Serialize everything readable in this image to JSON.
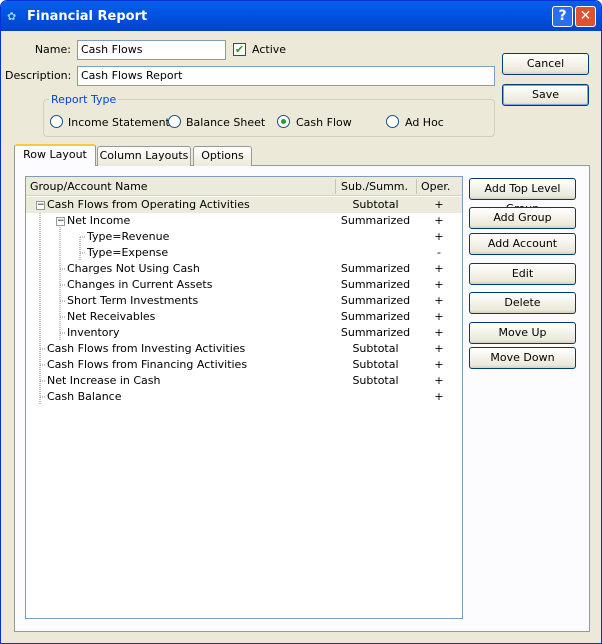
{
  "window": {
    "title": "Financial Report",
    "help": "?",
    "close": "✕"
  },
  "form": {
    "name_label": "Name:",
    "name_value": "Cash Flows",
    "active_label": "Active",
    "active_checked": true,
    "description_label": "Description:",
    "description_value": "Cash Flows Report"
  },
  "buttons": {
    "cancel": "Cancel",
    "save": "Save"
  },
  "report_type": {
    "label": "Report Type",
    "options": [
      "Income Statement",
      "Balance Sheet",
      "Cash Flow",
      "Ad Hoc"
    ],
    "selected": "Cash Flow"
  },
  "tabs": [
    "Row Layout",
    "Column Layouts",
    "Options"
  ],
  "tree": {
    "columns": [
      "Group/Account Name",
      "Sub./Summ.",
      "Oper."
    ],
    "rows": [
      {
        "name": "Cash Flows from Operating Activities",
        "sub": "Subtotal",
        "op": "+",
        "level": 0,
        "expanded": true
      },
      {
        "name": "Net Income",
        "sub": "Summarized",
        "op": "+",
        "level": 1,
        "expanded": true
      },
      {
        "name": "Type=Revenue",
        "sub": "",
        "op": "+",
        "level": 2
      },
      {
        "name": "Type=Expense",
        "sub": "",
        "op": "-",
        "level": 2
      },
      {
        "name": "Charges Not Using Cash",
        "sub": "Summarized",
        "op": "+",
        "level": 1
      },
      {
        "name": "Changes in Current Assets",
        "sub": "Summarized",
        "op": "+",
        "level": 1
      },
      {
        "name": "Short Term Investments",
        "sub": "Summarized",
        "op": "+",
        "level": 1
      },
      {
        "name": "Net Receivables",
        "sub": "Summarized",
        "op": "+",
        "level": 1
      },
      {
        "name": "Inventory",
        "sub": "Summarized",
        "op": "+",
        "level": 1
      },
      {
        "name": "Cash Flows from Investing Activities",
        "sub": "Subtotal",
        "op": "+",
        "level": 0
      },
      {
        "name": "Cash Flows from Financing Activities",
        "sub": "Subtotal",
        "op": "+",
        "level": 0
      },
      {
        "name": "Net Increase in Cash",
        "sub": "Subtotal",
        "op": "+",
        "level": 0
      },
      {
        "name": "Cash Balance",
        "sub": "",
        "op": "+",
        "level": 0
      }
    ]
  },
  "side_buttons": [
    "Add Top Level Group",
    "Add Group",
    "Add Account",
    "Edit",
    "Delete",
    "Move Up",
    "Move Down"
  ]
}
